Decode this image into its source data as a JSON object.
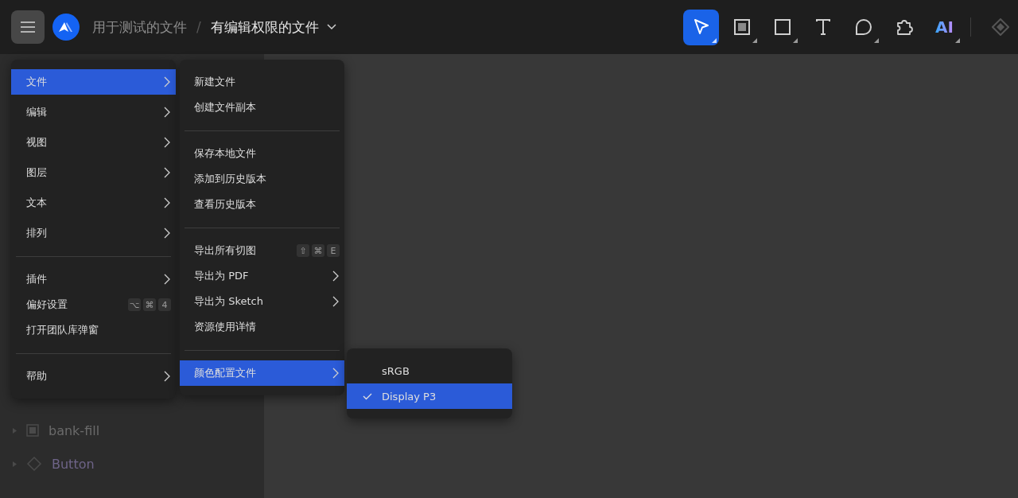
{
  "topbar": {
    "breadcrumb": {
      "parent": "用于测试的文件",
      "separator": "/",
      "current": "有编辑权限的文件"
    },
    "tools": [
      {
        "kind": "move",
        "selected": true,
        "dropdown": true
      },
      {
        "kind": "frame",
        "selected": false,
        "dropdown": true
      },
      {
        "kind": "shape",
        "selected": false,
        "dropdown": true
      },
      {
        "kind": "text",
        "selected": false,
        "dropdown": false
      },
      {
        "kind": "comment",
        "selected": false,
        "dropdown": true
      },
      {
        "kind": "plugin",
        "selected": false,
        "dropdown": false
      },
      {
        "kind": "ai",
        "label": "AI",
        "selected": false,
        "dropdown": true
      },
      {
        "kind": "component",
        "selected": false,
        "dropdown": false
      }
    ]
  },
  "layers": [
    {
      "kind": "frame",
      "name": "bank-fill"
    },
    {
      "kind": "component",
      "name": "Button"
    }
  ],
  "main_menu": [
    {
      "kind": "item",
      "label": "文件",
      "submenu": true,
      "selected": true
    },
    {
      "kind": "item",
      "label": "编辑",
      "submenu": true,
      "selected": false
    },
    {
      "kind": "item",
      "label": "视图",
      "submenu": true,
      "selected": false
    },
    {
      "kind": "item",
      "label": "图层",
      "submenu": true,
      "selected": false
    },
    {
      "kind": "item",
      "label": "文本",
      "submenu": true,
      "selected": false
    },
    {
      "kind": "item",
      "label": "排列",
      "submenu": true,
      "selected": false
    },
    {
      "kind": "divider"
    },
    {
      "kind": "item",
      "label": "插件",
      "submenu": true,
      "selected": false
    },
    {
      "kind": "item",
      "label": "偏好设置",
      "shortcut": [
        "⌥",
        "⌘",
        "4"
      ],
      "selected": false
    },
    {
      "kind": "item",
      "label": "打开团队库弹窗",
      "selected": false
    },
    {
      "kind": "divider"
    },
    {
      "kind": "item",
      "label": "帮助",
      "submenu": true,
      "selected": false
    }
  ],
  "file_menu": [
    {
      "kind": "item",
      "label": "新建文件",
      "selected": false
    },
    {
      "kind": "item",
      "label": "创建文件副本",
      "selected": false
    },
    {
      "kind": "divider"
    },
    {
      "kind": "item",
      "label": "保存本地文件",
      "selected": false
    },
    {
      "kind": "item",
      "label": "添加到历史版本",
      "selected": false
    },
    {
      "kind": "item",
      "label": "查看历史版本",
      "selected": false
    },
    {
      "kind": "divider"
    },
    {
      "kind": "item",
      "label": "导出所有切图",
      "shortcut": [
        "⇧",
        "⌘",
        "E"
      ],
      "selected": false
    },
    {
      "kind": "item",
      "label": "导出为 PDF",
      "submenu": true,
      "selected": false
    },
    {
      "kind": "item",
      "label": "导出为 Sketch",
      "submenu": true,
      "selected": false
    },
    {
      "kind": "item",
      "label": "资源使用详情",
      "selected": false
    },
    {
      "kind": "divider"
    },
    {
      "kind": "item",
      "label": "颜色配置文件",
      "submenu": true,
      "selected": true
    }
  ],
  "color_profile_menu": [
    {
      "label": "sRGB",
      "checked": false,
      "selected": false
    },
    {
      "label": "Display P3",
      "checked": true,
      "selected": true
    }
  ]
}
